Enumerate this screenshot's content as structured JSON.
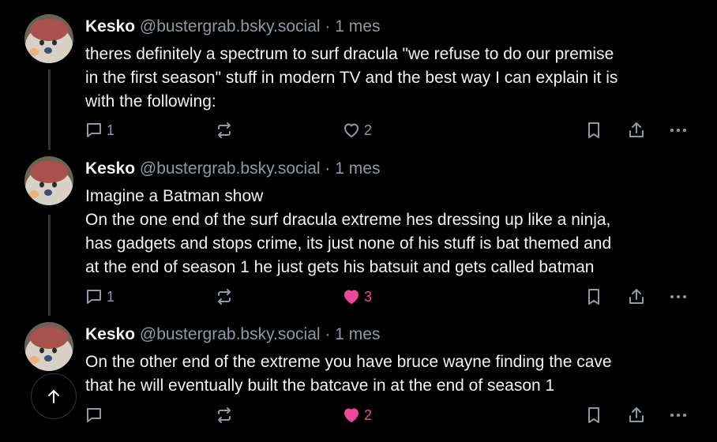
{
  "posts": [
    {
      "author": "Kesko",
      "handle": "@bustergrab.bsky.social",
      "separator": "·",
      "time": "1 mes",
      "text": "theres definitely a spectrum to surf dracula \"we refuse to do our premise\nin the first season\" stuff in modern TV and the best way I can explain it is\nwith the following:",
      "replies": "1",
      "reposts": "",
      "likes": "2",
      "liked": false
    },
    {
      "author": "Kesko",
      "handle": "@bustergrab.bsky.social",
      "separator": "·",
      "time": "1 mes",
      "text": "Imagine a Batman show\nOn the one end of the surf dracula extreme hes dressing up like a ninja,\nhas gadgets and stops crime, its just none of his stuff is bat themed and\nat the end of season 1 he just gets his batsuit and gets called batman",
      "replies": "1",
      "reposts": "",
      "likes": "3",
      "liked": true
    },
    {
      "author": "Kesko",
      "handle": "@bustergrab.bsky.social",
      "separator": "·",
      "time": "1 mes",
      "text": "On the other end of the extreme you have bruce wayne finding the cave\nthat he will eventually built the batcave in at the end of season 1",
      "replies": "",
      "reposts": "",
      "likes": "2",
      "liked": true
    }
  ],
  "colors": {
    "background": "#000000",
    "text": "#f1f3f5",
    "muted": "#8e99a4",
    "like": "#ec4899",
    "thread_line": "#2e3439"
  },
  "icons": {
    "reply": "speech-bubble-icon",
    "repost": "repost-arrows-icon",
    "like": "heart-icon",
    "bookmark": "bookmark-icon",
    "share": "share-icon",
    "more": "ellipsis-icon",
    "scroll_top": "arrow-up-icon"
  }
}
